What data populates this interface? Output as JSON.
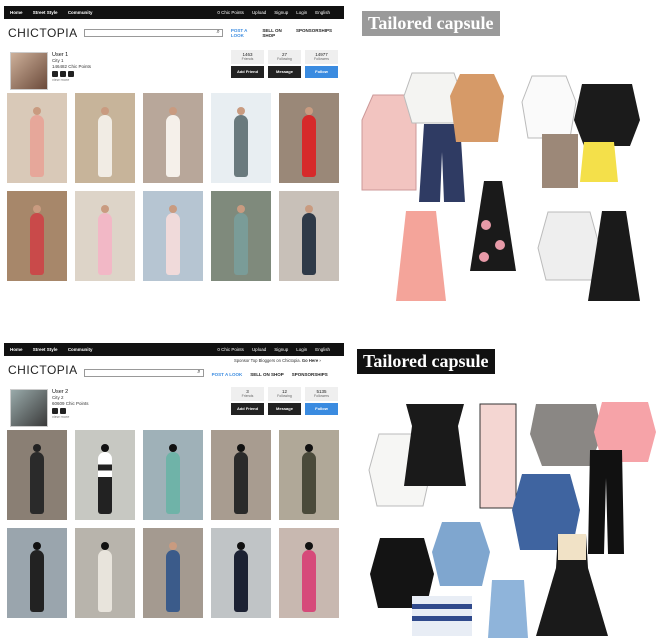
{
  "panel1": {
    "topbar_left": [
      "Home",
      "Street Style",
      "Community"
    ],
    "topbar_right": [
      "0 Chic Points",
      "Upload",
      "Signup",
      "Login",
      "English"
    ],
    "logo": "CHICTOPIA",
    "nav": [
      "POST A LOOK",
      "SELL ON SHOP",
      "SPONSORSHIPS"
    ],
    "user": {
      "name": "User 1",
      "line2": "City 1",
      "points": "146482 Chic Points",
      "more": "view more"
    },
    "stats": [
      {
        "value": "1463",
        "label": "Friends"
      },
      {
        "value": "27",
        "label": "Following"
      },
      {
        "value": "14977",
        "label": "Followers"
      }
    ],
    "buttons": [
      "Add Friend",
      "Message",
      "Follow"
    ],
    "title": "Tailored capsule"
  },
  "panel2": {
    "topbar_left": [
      "Home",
      "Street Style",
      "Community"
    ],
    "topbar_right": [
      "0 Chic Points",
      "Upload",
      "Signup",
      "Login",
      "English"
    ],
    "logo": "CHICTOPIA",
    "promo": "Sponsor Top Bloggers on Chictopia.",
    "promo_link": "Go Here ›",
    "nav": [
      "POST A LOOK",
      "SELL ON SHOP",
      "SPONSORSHIPS"
    ],
    "user": {
      "name": "User 2",
      "line2": "City 2",
      "points": "60609 Chic Points",
      "more": "view more"
    },
    "stats": [
      {
        "value": "3",
        "label": "Friends"
      },
      {
        "value": "12",
        "label": "Following"
      },
      {
        "value": "5135",
        "label": "Followers"
      }
    ],
    "buttons": [
      "Add Friend",
      "Message",
      "Follow"
    ],
    "title": "Tailored capsule"
  },
  "colors": {
    "topbar": "#111111",
    "accent": "#3a8be0"
  }
}
